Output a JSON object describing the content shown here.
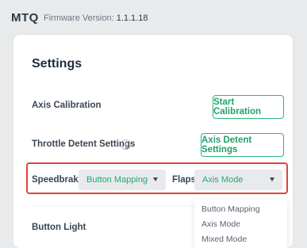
{
  "header": {
    "app_name": "MTQ",
    "firmware_label": "Firmware Version:",
    "firmware_version": "1.1.1.18"
  },
  "settings": {
    "title": "Settings",
    "axis_calibration": {
      "label": "Axis Calibration",
      "button": "Start Calibration"
    },
    "throttle_detent": {
      "label": "Throttle Detent Settings",
      "info_icon": "info-icon",
      "button": "Axis Detent Settings"
    },
    "speedbrake": {
      "label": "Speedbrake",
      "value": "Button Mapping"
    },
    "flaps": {
      "label": "Flaps",
      "value": "Axis Mode"
    },
    "button_light": {
      "label": "Button Light"
    }
  },
  "flaps_dropdown": {
    "options": [
      "Button Mapping",
      "Axis Mode",
      "Mixed Mode"
    ]
  },
  "colors": {
    "accent": "#1fa26a",
    "highlight": "#e0433a",
    "background": "#e9eaec"
  }
}
